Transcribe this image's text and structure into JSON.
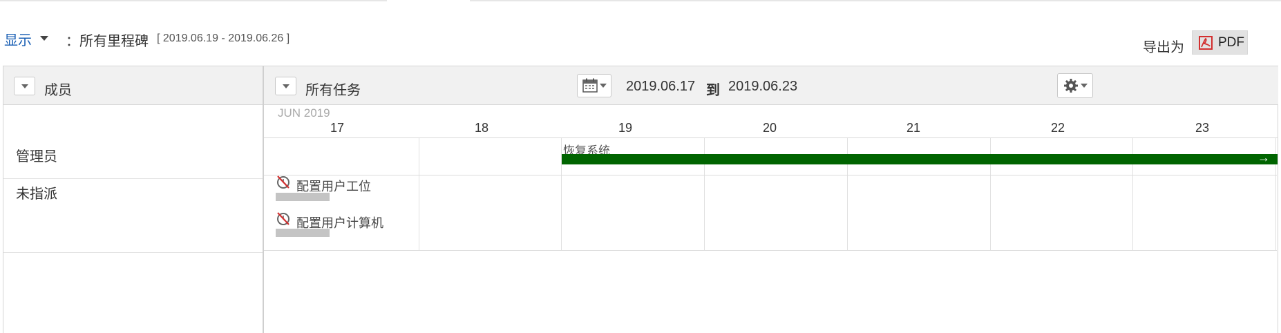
{
  "toolbar": {
    "show_label": "显示",
    "colon": "：",
    "milestone_filter": "所有里程碑",
    "milestone_range": "[ 2019.06.19 - 2019.06.26 ]",
    "export_label": "导出为",
    "pdf_label": "PDF"
  },
  "grid_header": {
    "members_label": "成员",
    "tasks_label": "所有任务",
    "date_from": "2019.06.17",
    "date_to_word": "到",
    "date_to": "2019.06.23"
  },
  "members": [
    "管理员",
    "未指派"
  ],
  "calendar": {
    "month": "JUN 2019",
    "days": [
      "17",
      "18",
      "19",
      "20",
      "21",
      "22",
      "23"
    ]
  },
  "tasks": {
    "bar": {
      "label": "恢复系统",
      "arrow": "→",
      "color": "#006400"
    },
    "unassigned": [
      {
        "name": "配置用户工位"
      },
      {
        "name": "配置用户计算机"
      }
    ]
  },
  "icons": {
    "pdf": "pdf-icon",
    "calendar": "calendar-icon",
    "gear": "gear-icon",
    "task": "task-no-time-icon"
  },
  "colors": {
    "link": "#1a5fb4",
    "bar": "#006400",
    "header_bg": "#f1f1f1"
  }
}
